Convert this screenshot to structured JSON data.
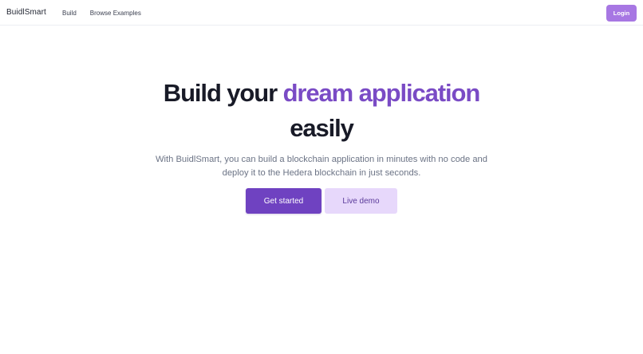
{
  "navbar": {
    "brand": "BuidlSmart",
    "links": [
      "Build",
      "Browse Examples"
    ],
    "login_label": "Login"
  },
  "hero": {
    "title_part1": "Build your ",
    "title_accent": "dream application",
    "title_part2": "easily",
    "subtitle_line1": "With BuidlSmart, you can build a blockchain application in minutes with no code and",
    "subtitle_line2": "deploy it to the Hedera blockchain in just seconds.",
    "primary_cta": "Get started",
    "secondary_cta": "Live demo"
  },
  "colors": {
    "accent": "#7a4bc5",
    "primary_button": "#6f42c1",
    "secondary_button": "#e7d8fb",
    "login_button": "#a777e3"
  }
}
